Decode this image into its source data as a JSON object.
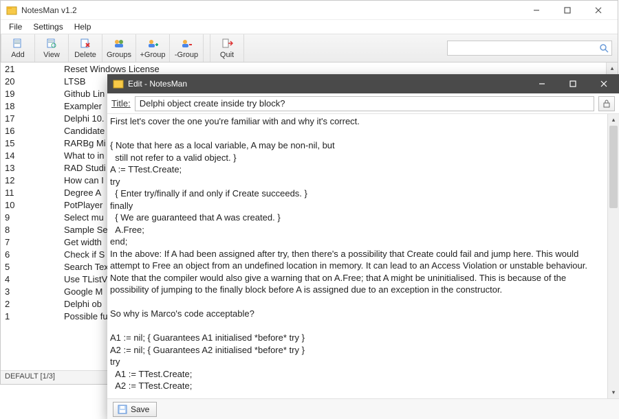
{
  "main": {
    "title": "NotesMan v1.2",
    "menu": {
      "file": "File",
      "settings": "Settings",
      "help": "Help"
    },
    "toolbar": {
      "add": "Add",
      "view": "View",
      "delete": "Delete",
      "groups": "Groups",
      "plusGroup": "+Group",
      "minusGroup": "-Group",
      "quit": "Quit"
    },
    "search": {
      "placeholder": ""
    },
    "status": "DEFAULT [1/3]",
    "items": [
      {
        "n": "21",
        "name": "Reset Windows License"
      },
      {
        "n": "20",
        "name": "LTSB"
      },
      {
        "n": "19",
        "name": "Github Lin"
      },
      {
        "n": "18",
        "name": "Exampler"
      },
      {
        "n": "17",
        "name": "Delphi 10."
      },
      {
        "n": "16",
        "name": "Candidate"
      },
      {
        "n": "15",
        "name": "RARBg Mi"
      },
      {
        "n": "14",
        "name": "What to in"
      },
      {
        "n": "13",
        "name": "RAD Studi"
      },
      {
        "n": "12",
        "name": "How can I"
      },
      {
        "n": "11",
        "name": "Degree A"
      },
      {
        "n": "10",
        "name": "PotPlayer"
      },
      {
        "n": "9",
        "name": "Select mu"
      },
      {
        "n": "8",
        "name": "Sample Se"
      },
      {
        "n": "7",
        "name": "Get width"
      },
      {
        "n": "6",
        "name": "Check if S"
      },
      {
        "n": "5",
        "name": "Search Tex"
      },
      {
        "n": "4",
        "name": "Use TListV"
      },
      {
        "n": "3",
        "name": "Google M"
      },
      {
        "n": "2",
        "name": "Delphi ob"
      },
      {
        "n": "1",
        "name": "Possible fu"
      }
    ]
  },
  "edit": {
    "title": "Edit - NotesMan",
    "titleLabel": "Title:",
    "noteTitle": "Delphi object create inside try block?",
    "save": "Save",
    "body": "First let's cover the one you're familiar with and why it's correct.\n\n{ Note that here as a local variable, A may be non-nil, but\n  still not refer to a valid object. }\nA := TTest.Create;\ntry\n  { Enter try/finally if and only if Create succeeds. }\nfinally\n  { We are guaranteed that A was created. }\n  A.Free;\nend;\nIn the above: If A had been assigned after try, then there's a possibility that Create could fail and jump here. This would attempt to Free an object from an undefined location in memory. It can lead to an Access Violation or unstable behaviour. Note that the compiler would also give a warning that on A.Free; that A might be uninitialised. This is because of the possibility of jumping to the finally block before A is assigned due to an exception in the constructor.\n\nSo why is Marco's code acceptable?\n\nA1 := nil; { Guarantees A1 initialised *before* try }\nA2 := nil; { Guarantees A2 initialised *before* try }\ntry\n  A1 := TTest.Create;\n  A2 := TTest.Create;"
  }
}
